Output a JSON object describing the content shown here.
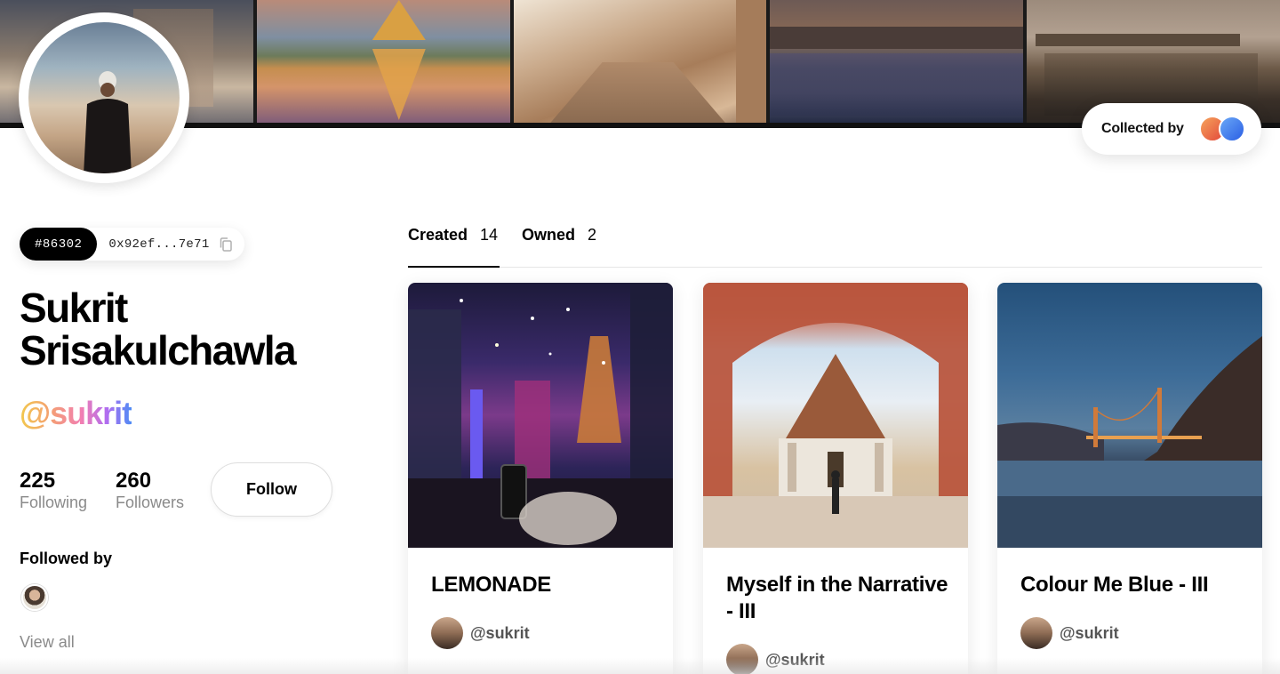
{
  "cover": {
    "tiles": [
      "tile-1",
      "tile-2",
      "tile-3",
      "tile-4",
      "tile-5"
    ]
  },
  "collected_by": {
    "label": "Collected by",
    "collector_colors": [
      "#e8663f",
      "#3b73ec"
    ]
  },
  "profile": {
    "token_id": "#86302",
    "wallet_address": "0x92ef...7e71",
    "copy_icon": "copy-icon",
    "name_line_1": "Sukrit",
    "name_line_2": "Srisakulchawla",
    "handle": "@sukrit",
    "handle_gradient": [
      "#f2c94c",
      "#f4a36d",
      "#f27fb2",
      "#b06df0",
      "#4f8cf5"
    ],
    "following_count": "225",
    "following_label": "Following",
    "followers_count": "260",
    "followers_label": "Followers",
    "follow_button": "Follow",
    "followed_by_label": "Followed by",
    "view_all": "View all"
  },
  "tabs": [
    {
      "label": "Created",
      "count": "14",
      "active": true
    },
    {
      "label": "Owned",
      "count": "2",
      "active": false
    }
  ],
  "cards": [
    {
      "title": "LEMONADE",
      "creator": "@sukrit"
    },
    {
      "title": "Myself in the Narrative - III",
      "creator": "@sukrit"
    },
    {
      "title": "Colour Me Blue - III",
      "creator": "@sukrit"
    }
  ]
}
